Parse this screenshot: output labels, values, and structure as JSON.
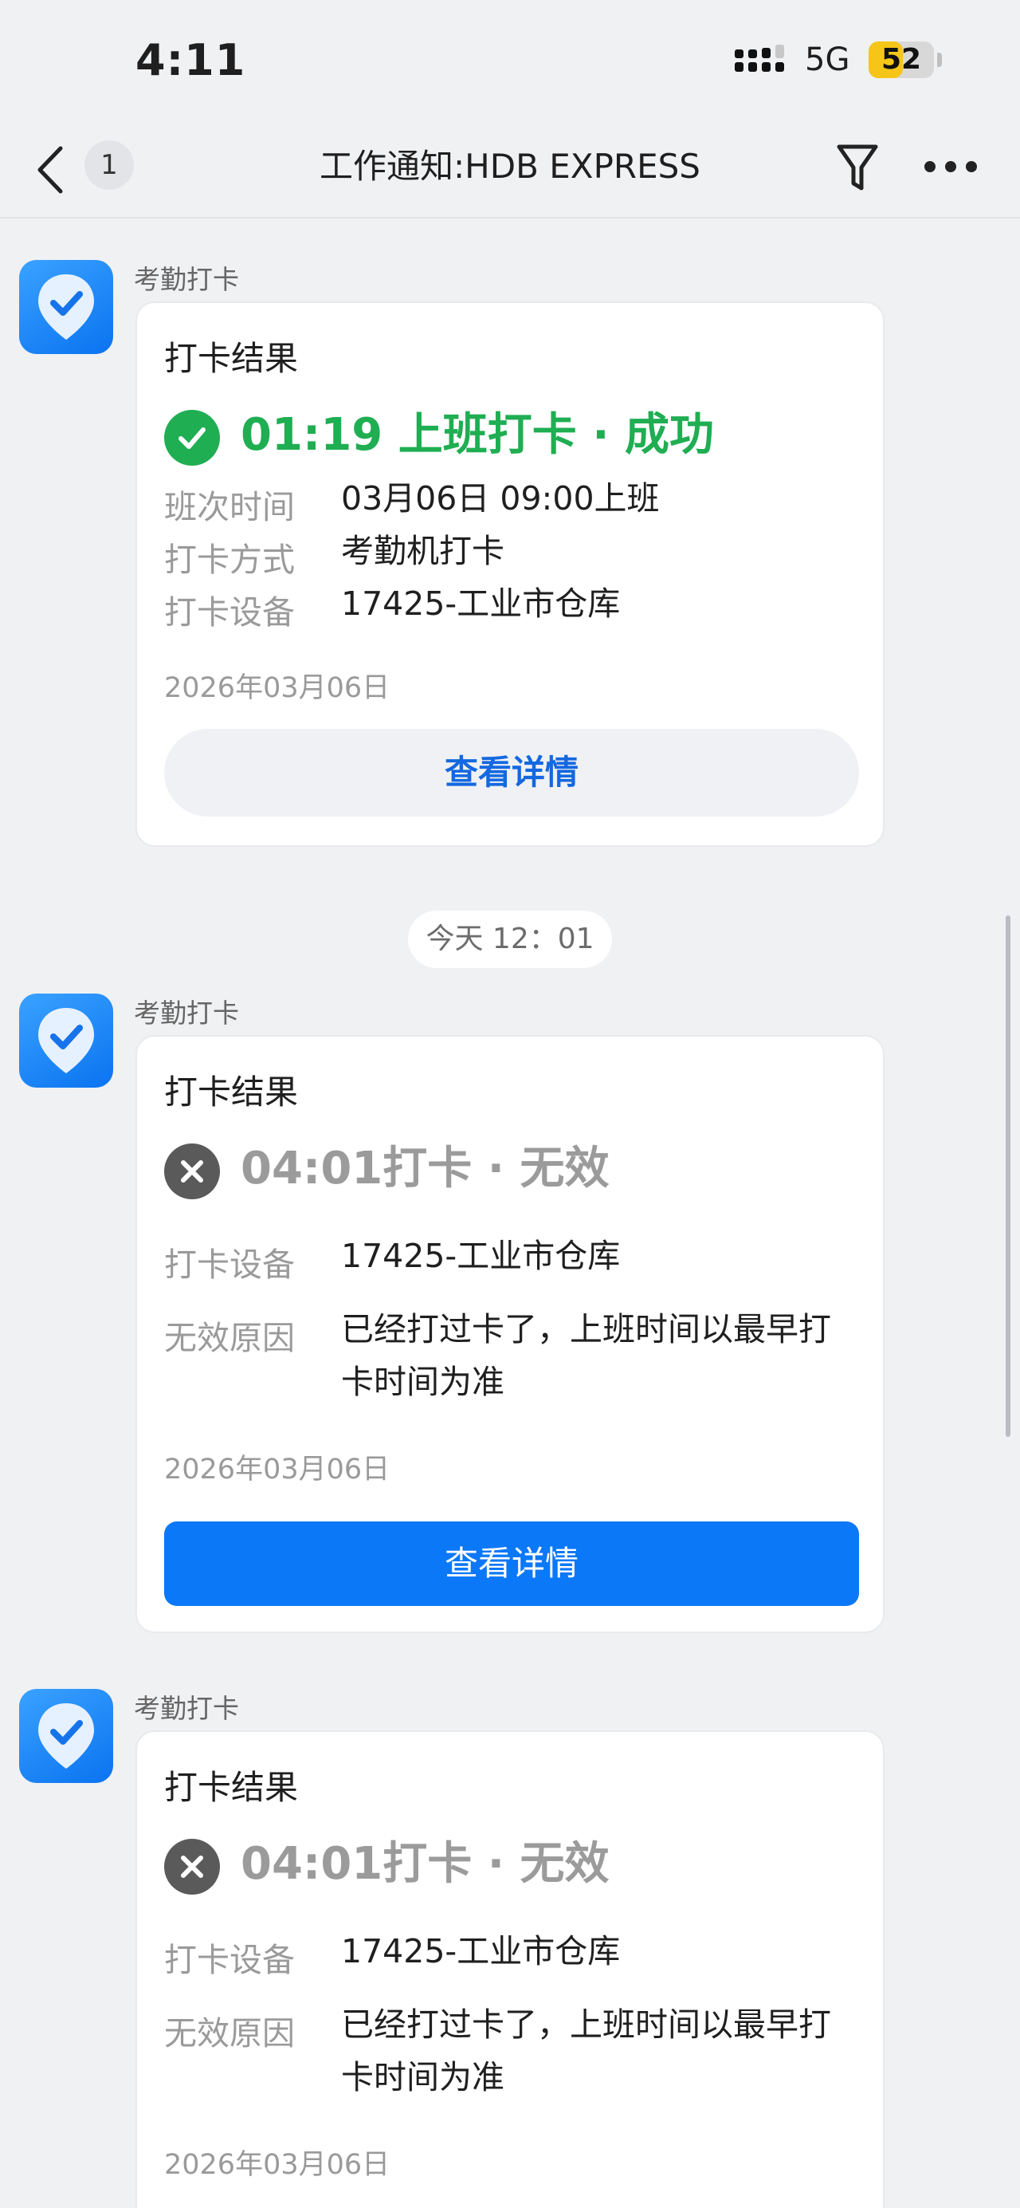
{
  "status_bar": {
    "time": "4:11",
    "network": "5G",
    "battery": "52",
    "battery_level": 0.52,
    "battery_color": "#f5c518"
  },
  "nav": {
    "back_icon": "chevron-left-icon",
    "unread_count": "1",
    "title": "工作通知:HDB EXPRESS",
    "filter_icon": "filter-icon",
    "more_icon": "more-icon"
  },
  "divider": {
    "time": "今天 12：01"
  },
  "messages": [
    {
      "sender": "考勤打卡",
      "title": "打卡结果",
      "result": "01:19 上班打卡 · 成功",
      "status": "success",
      "rows": [
        {
          "label": "班次时间",
          "value": "03月06日 09:00上班"
        },
        {
          "label": "打卡方式",
          "value": "考勤机打卡"
        },
        {
          "label": "打卡设备",
          "value": "17425-工业市仓库"
        }
      ],
      "date": "2026年03月06日",
      "button": "查看详情"
    },
    {
      "sender": "考勤打卡",
      "title": "打卡结果",
      "result": "04:01打卡 · 无效",
      "status": "invalid",
      "rows": [
        {
          "label": "打卡设备",
          "value": "17425-工业市仓库"
        },
        {
          "label": "无效原因",
          "value": "已经打过卡了，上班时间以最早打卡时间为准"
        }
      ],
      "date": "2026年03月06日",
      "button": "查看详情"
    },
    {
      "sender": "考勤打卡",
      "title": "打卡结果",
      "result": "04:01打卡 · 无效",
      "status": "invalid",
      "rows": [
        {
          "label": "打卡设备",
          "value": "17425-工业市仓库"
        },
        {
          "label": "无效原因",
          "value": "已经打过卡了，上班时间以最早打卡时间为准"
        }
      ],
      "date": "2026年03月06日"
    }
  ],
  "colors": {
    "success": "#1fae52",
    "invalid": "#9b9b9b",
    "primary": "#0b78f8",
    "link": "#1468e0"
  }
}
